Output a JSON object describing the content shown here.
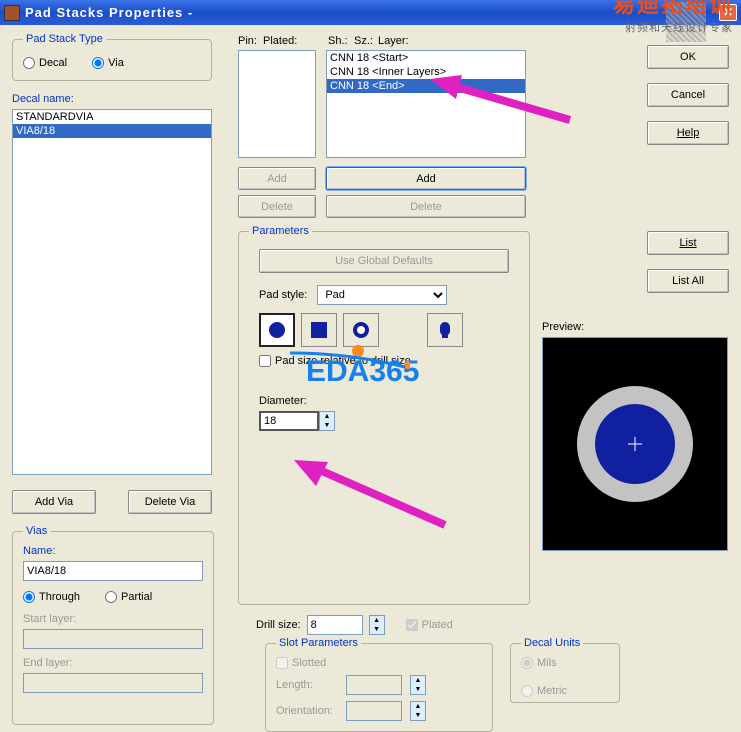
{
  "title": "Pad Stacks Properties -",
  "padStackType": {
    "legend": "Pad Stack Type",
    "decal": "Decal",
    "via": "Via"
  },
  "decalName": {
    "label": "Decal name:",
    "items": [
      "STANDARDVIA",
      "VIA8/18"
    ],
    "selectedIdx": 1
  },
  "leftBtns": {
    "addVia": "Add Via",
    "delVia": "Delete Via"
  },
  "vias": {
    "legend": "Vias",
    "nameLbl": "Name:",
    "nameVal": "VIA8/18",
    "through": "Through",
    "partial": "Partial",
    "startLayer": "Start layer:",
    "endLayer": "End layer:"
  },
  "cols": {
    "pin": "Pin:",
    "plated": "Plated:",
    "sh": "Sh.:",
    "sz": "Sz.:",
    "layer": "Layer:"
  },
  "layerList": {
    "items": [
      "CNN 18 <Start>",
      "CNN 18 <Inner Layers>",
      "CNN 18 <End>"
    ],
    "selectedIdx": 2
  },
  "midBtns": {
    "add1": "Add",
    "del1": "Delete",
    "add2": "Add",
    "del2": "Delete"
  },
  "params": {
    "legend": "Parameters",
    "useGlobal": "Use Global Defaults",
    "padStyle": "Pad style:",
    "padSel": "Pad",
    "relChk": "Pad size relative to drill size",
    "diameterLbl": "Diameter:",
    "diameterVal": "18"
  },
  "drill": {
    "label": "Drill size:",
    "val": "8",
    "plated": "Plated"
  },
  "slot": {
    "legend": "Slot Parameters",
    "slotted": "Slotted",
    "length": "Length:",
    "orient": "Orientation:"
  },
  "decalUnits": {
    "legend": "Decal Units",
    "mils": "Mils",
    "metric": "Metric"
  },
  "rightBtns": {
    "ok": "OK",
    "cancel": "Cancel",
    "help": "Help",
    "list": "List",
    "listAll": "List All"
  },
  "previewLbl": "Preview:",
  "watermark": "EDA365",
  "brand": {
    "big": "易迪拓培训",
    "sm": "射频和天线设计专家"
  }
}
